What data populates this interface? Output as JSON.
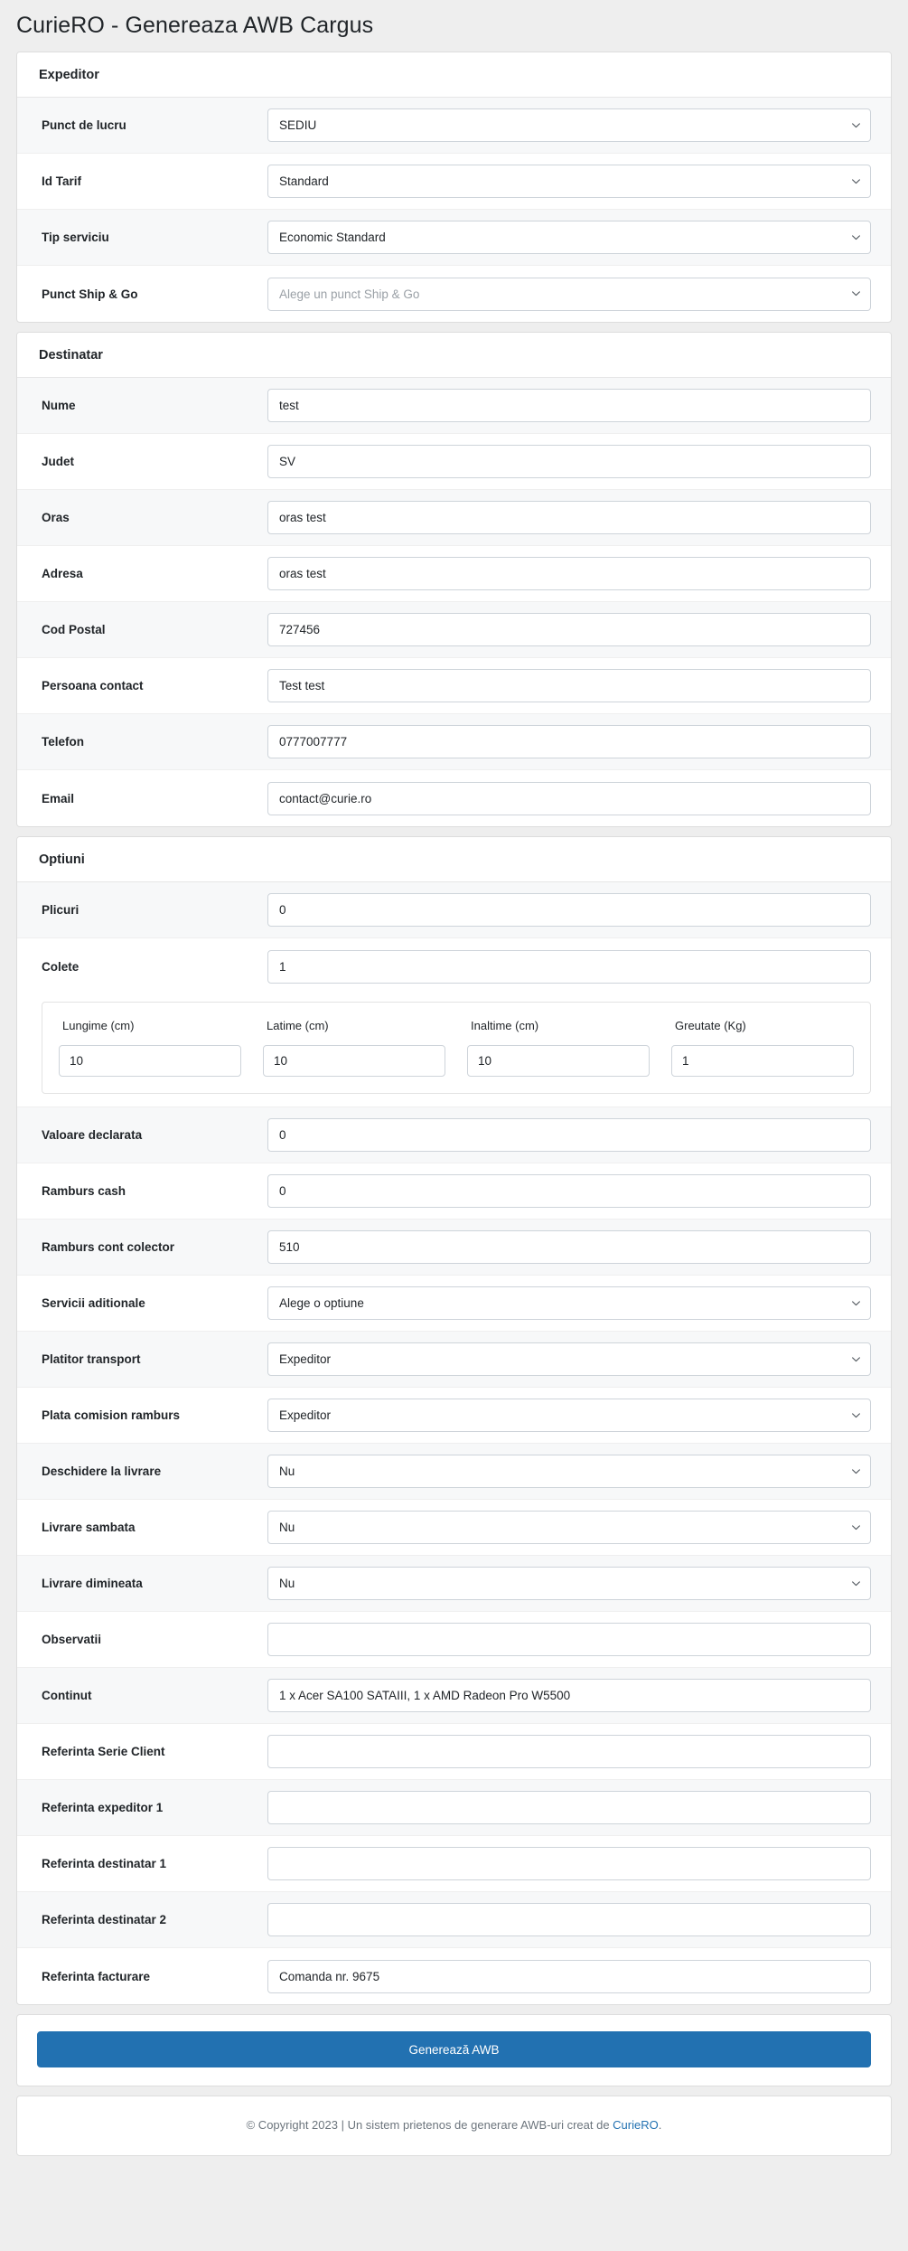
{
  "app": {
    "title": "CurieRO - Genereaza AWB Cargus"
  },
  "sections": {
    "expeditor": {
      "header": "Expeditor",
      "rows": [
        {
          "label": "Punct de lucru",
          "type": "select",
          "value": "SEDIU",
          "placeholder": ""
        },
        {
          "label": "Id Tarif",
          "type": "select",
          "value": "Standard",
          "placeholder": ""
        },
        {
          "label": "Tip serviciu",
          "type": "select",
          "value": "Economic Standard",
          "placeholder": ""
        },
        {
          "label": "Punct Ship & Go",
          "type": "select",
          "value": "",
          "placeholder": "Alege un punct Ship & Go"
        }
      ]
    },
    "destinatar": {
      "header": "Destinatar",
      "rows": [
        {
          "label": "Nume",
          "type": "text",
          "value": "test",
          "placeholder": ""
        },
        {
          "label": "Judet",
          "type": "text",
          "value": "SV",
          "placeholder": ""
        },
        {
          "label": "Oras",
          "type": "text",
          "value": "oras test",
          "placeholder": ""
        },
        {
          "label": "Adresa",
          "type": "text",
          "value": "oras test",
          "placeholder": ""
        },
        {
          "label": "Cod Postal",
          "type": "text",
          "value": "727456",
          "placeholder": ""
        },
        {
          "label": "Persoana contact",
          "type": "text",
          "value": "Test test",
          "placeholder": ""
        },
        {
          "label": "Telefon",
          "type": "text",
          "value": "0777007777",
          "placeholder": ""
        },
        {
          "label": "Email",
          "type": "text",
          "value": "contact@curie.ro",
          "placeholder": ""
        }
      ]
    },
    "optiuni": {
      "header": "Optiuni",
      "rows_top": [
        {
          "label": "Plicuri",
          "type": "text",
          "value": "0",
          "placeholder": ""
        },
        {
          "label": "Colete",
          "type": "text",
          "value": "1",
          "placeholder": ""
        }
      ],
      "dimensions": {
        "columns": [
          {
            "label": "Lungime (cm)",
            "value": "10"
          },
          {
            "label": "Latime (cm)",
            "value": "10"
          },
          {
            "label": "Inaltime (cm)",
            "value": "10"
          },
          {
            "label": "Greutate (Kg)",
            "value": "1"
          }
        ]
      },
      "rows_bottom": [
        {
          "label": "Valoare declarata",
          "type": "text",
          "value": "0",
          "placeholder": ""
        },
        {
          "label": "Ramburs cash",
          "type": "text",
          "value": "0",
          "placeholder": ""
        },
        {
          "label": "Ramburs cont colector",
          "type": "text",
          "value": "510",
          "placeholder": ""
        },
        {
          "label": "Servicii aditionale",
          "type": "select",
          "value": "Alege o optiune",
          "placeholder": ""
        },
        {
          "label": "Platitor transport",
          "type": "select",
          "value": "Expeditor",
          "placeholder": ""
        },
        {
          "label": "Plata comision ramburs",
          "type": "select",
          "value": "Expeditor",
          "placeholder": ""
        },
        {
          "label": "Deschidere la livrare",
          "type": "select",
          "value": "Nu",
          "placeholder": ""
        },
        {
          "label": "Livrare sambata",
          "type": "select",
          "value": "Nu",
          "placeholder": ""
        },
        {
          "label": "Livrare dimineata",
          "type": "select",
          "value": "Nu",
          "placeholder": ""
        },
        {
          "label": "Observatii",
          "type": "text",
          "value": "",
          "placeholder": ""
        },
        {
          "label": "Continut",
          "type": "text",
          "value": "1 x Acer SA100 SATAIII, 1 x AMD Radeon Pro W5500",
          "placeholder": ""
        },
        {
          "label": "Referinta Serie Client",
          "type": "text",
          "value": "",
          "placeholder": ""
        },
        {
          "label": "Referinta expeditor 1",
          "type": "text",
          "value": "",
          "placeholder": ""
        },
        {
          "label": "Referinta destinatar 1",
          "type": "text",
          "value": "",
          "placeholder": ""
        },
        {
          "label": "Referinta destinatar 2",
          "type": "text",
          "value": "",
          "placeholder": ""
        },
        {
          "label": "Referinta facturare",
          "type": "text",
          "value": "Comanda nr. 9675",
          "placeholder": ""
        }
      ]
    }
  },
  "submit": {
    "label": "Generează AWB"
  },
  "footer": {
    "text_before": "© Copyright 2023 | Un sistem prietenos de generare AWB-uri creat de ",
    "link_label": "CurieRO",
    "text_after": "."
  },
  "colors": {
    "accent": "#2271b1",
    "page_bg": "#eeeeee",
    "card_bg": "#ffffff",
    "stripe_bg": "#f7f8f9",
    "border": "#ced4da",
    "text": "#212529",
    "muted": "#6c757d",
    "placeholder": "#9aa0a6"
  }
}
